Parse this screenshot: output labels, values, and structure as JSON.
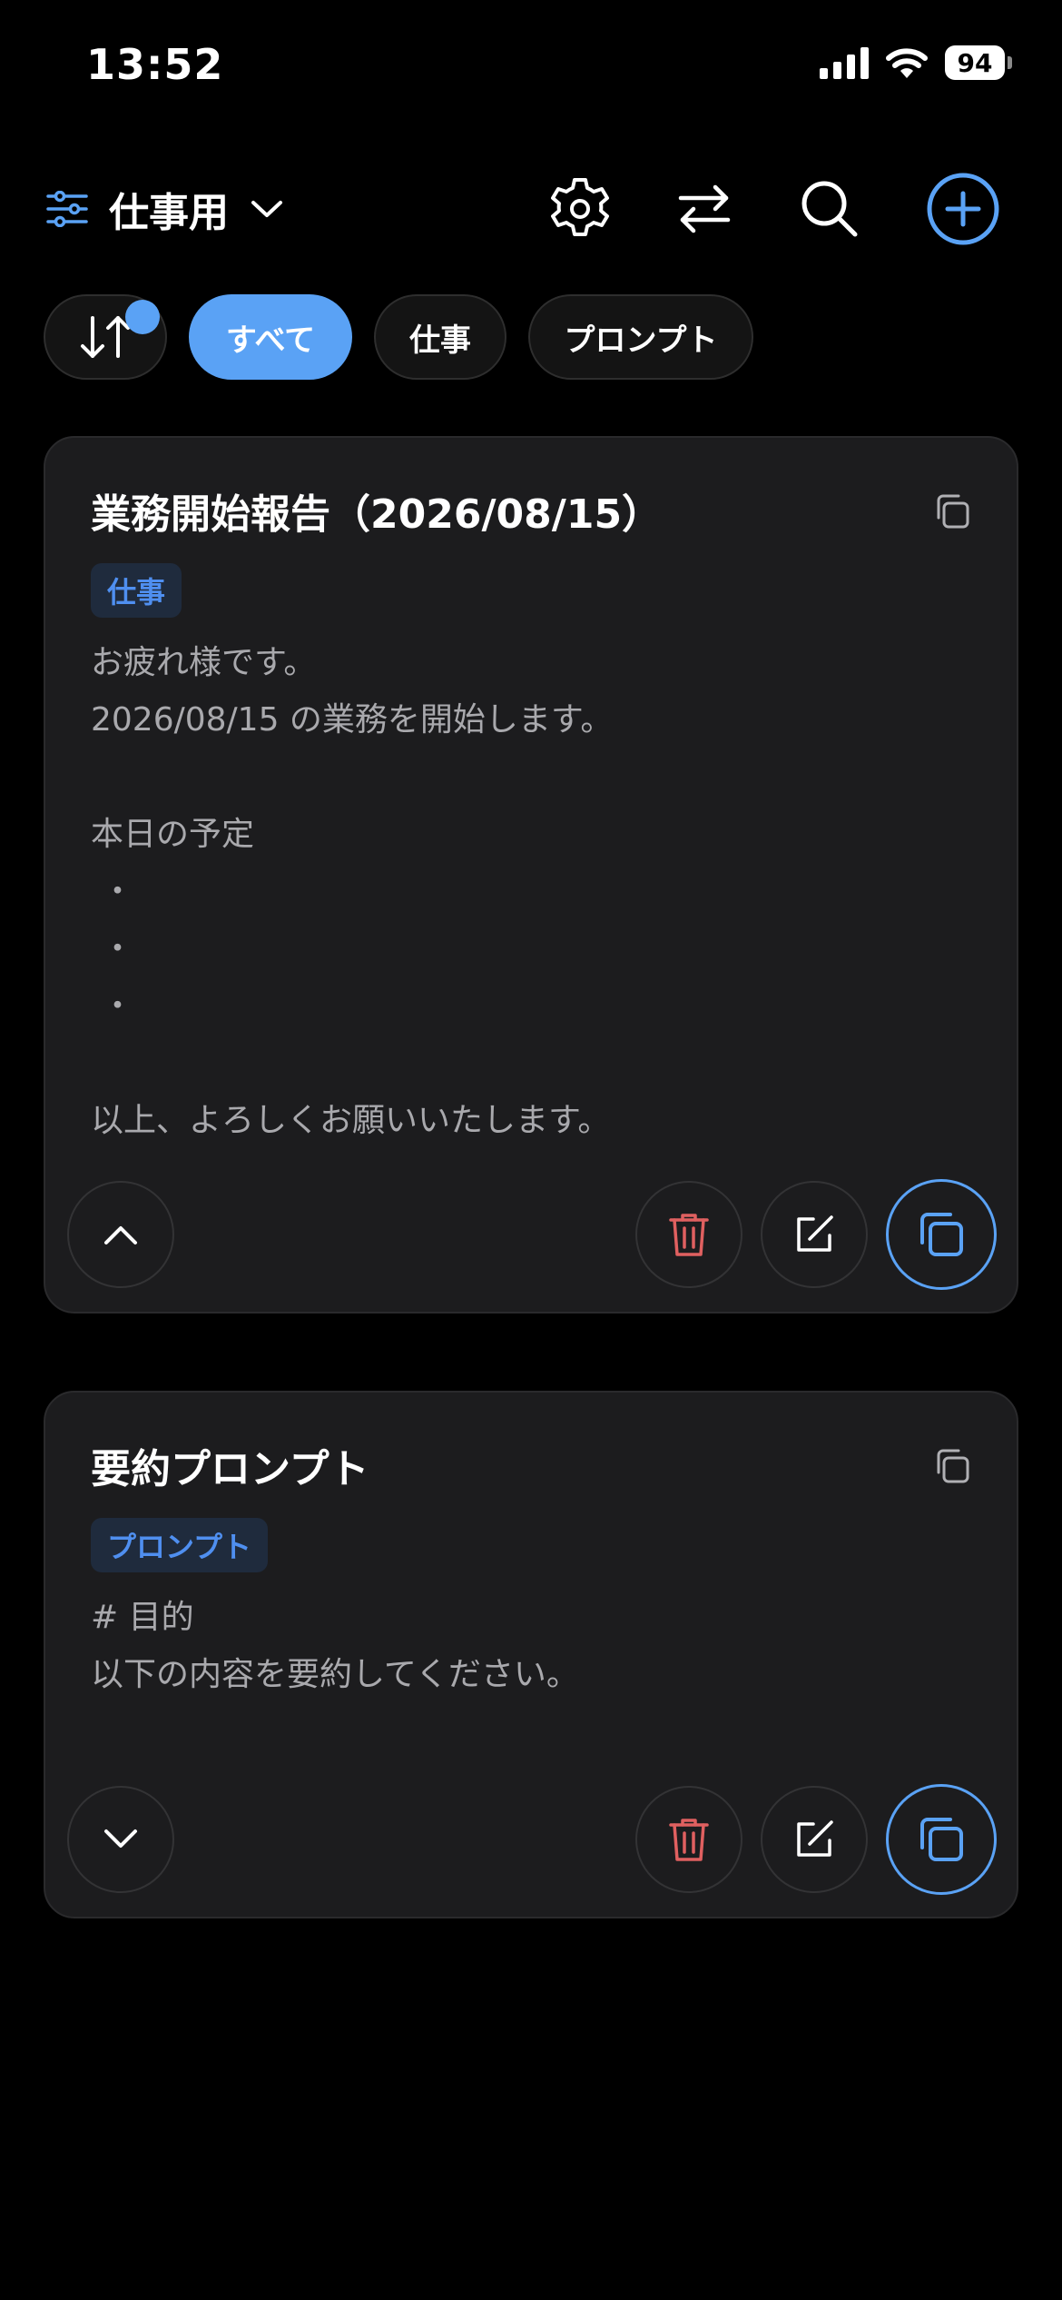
{
  "status_bar": {
    "time": "13:52",
    "battery": "94"
  },
  "header": {
    "profile_name": "仕事用"
  },
  "filters": {
    "chips": [
      {
        "label": "すべて",
        "active": true
      },
      {
        "label": "仕事",
        "active": false
      },
      {
        "label": "プロンプト",
        "active": false
      }
    ]
  },
  "cards": [
    {
      "title": "業務開始報告（2026/08/15）",
      "tag": "仕事",
      "body": "お疲れ様です。\n2026/08/15 の業務を開始します。\n\n本日の予定\n ・\n ・\n ・\n\n以上、よろしくお願いいたします。",
      "expanded": true
    },
    {
      "title": "要約プロンプト",
      "tag": "プロンプト",
      "body": "# 目的\n以下の内容を要約してください。",
      "expanded": false
    }
  ],
  "colors": {
    "accent": "#5aa2f5",
    "delete": "#e06060",
    "tag_text": "#4f8ff0",
    "card_bg": "#1c1c1e"
  },
  "icons": [
    "sliders-icon",
    "chevron-down-icon",
    "gear-icon",
    "swap-icon",
    "search-icon",
    "plus-circle-icon",
    "sort-icon",
    "copy-icon",
    "chevron-up-icon",
    "trash-icon",
    "edit-icon"
  ]
}
